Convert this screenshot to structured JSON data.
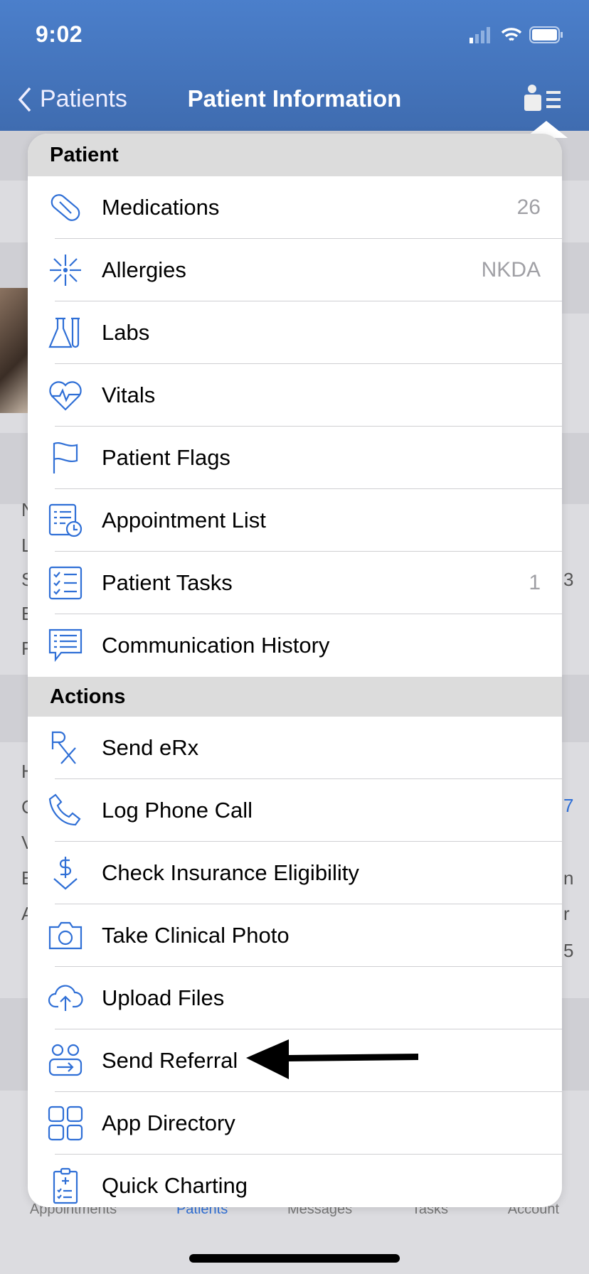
{
  "status_bar": {
    "time": "9:02"
  },
  "nav": {
    "back_label": "Patients",
    "title": "Patient Information"
  },
  "background_fragments": [
    "N",
    "L",
    "S",
    "E",
    "F",
    "3",
    "H",
    "C",
    "V",
    "E",
    "A",
    "7",
    "n",
    "r",
    "5"
  ],
  "menu": {
    "patient_section": {
      "title": "Patient",
      "items": [
        {
          "label": "Medications",
          "value": "26",
          "icon": "pill-icon"
        },
        {
          "label": "Allergies",
          "value": "NKDA",
          "icon": "allergy-icon"
        },
        {
          "label": "Labs",
          "value": "",
          "icon": "flask-icon"
        },
        {
          "label": "Vitals",
          "value": "",
          "icon": "heart-pulse-icon"
        },
        {
          "label": "Patient Flags",
          "value": "",
          "icon": "flag-icon"
        },
        {
          "label": "Appointment List",
          "value": "",
          "icon": "calendar-list-icon"
        },
        {
          "label": "Patient Tasks",
          "value": "1",
          "icon": "checklist-icon"
        },
        {
          "label": "Communication History",
          "value": "",
          "icon": "chat-icon"
        }
      ]
    },
    "actions_section": {
      "title": "Actions",
      "items": [
        {
          "label": "Send eRx",
          "icon": "rx-icon"
        },
        {
          "label": "Log Phone Call",
          "icon": "phone-icon"
        },
        {
          "label": "Check Insurance Eligibility",
          "icon": "dollar-check-icon"
        },
        {
          "label": "Take Clinical Photo",
          "icon": "camera-icon"
        },
        {
          "label": "Upload Files",
          "icon": "cloud-upload-icon"
        },
        {
          "label": "Send Referral",
          "icon": "referral-icon"
        },
        {
          "label": "App Directory",
          "icon": "grid-icon"
        },
        {
          "label": "Quick Charting",
          "icon": "clipboard-icon"
        }
      ]
    }
  },
  "tab_bar": {
    "items": [
      "Appointments",
      "Patients",
      "Messages",
      "Tasks",
      "Account"
    ],
    "active": "Patients"
  },
  "colors": {
    "header": "#4477c0",
    "accent": "#2f6fd6"
  }
}
